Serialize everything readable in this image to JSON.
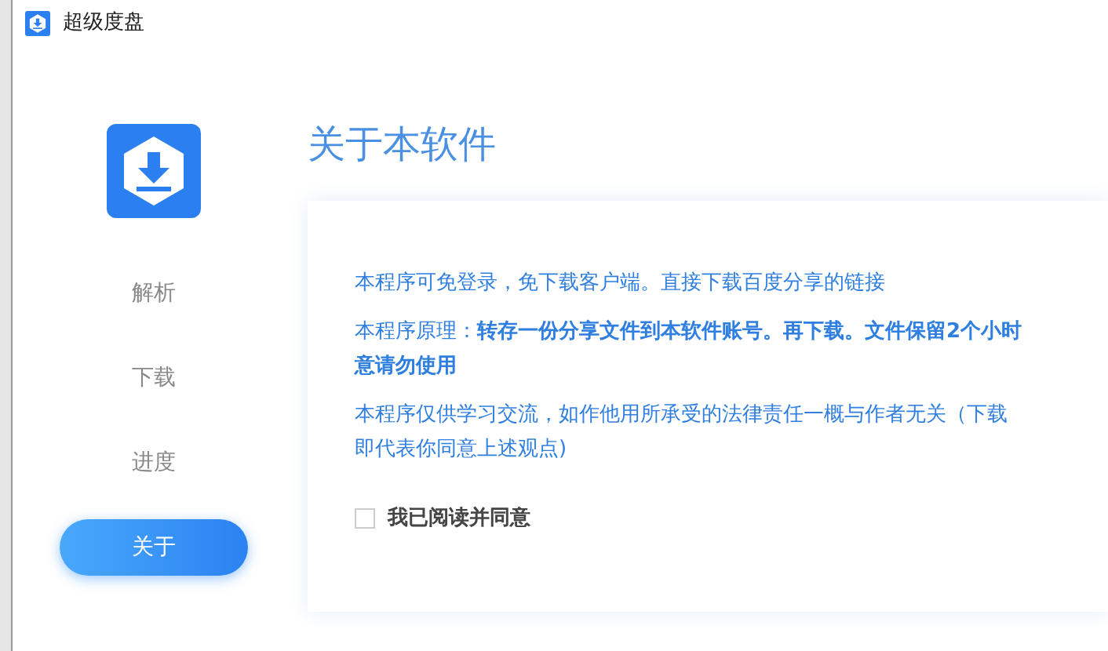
{
  "window": {
    "title": "超级度盘"
  },
  "sidebar": {
    "items": [
      {
        "label": "解析",
        "selected": false
      },
      {
        "label": "下载",
        "selected": false
      },
      {
        "label": "进度",
        "selected": false
      },
      {
        "label": "关于",
        "selected": true
      }
    ]
  },
  "page": {
    "title": "关于本软件",
    "paragraphs": [
      {
        "lines": [
          "本程序可免登录，免下载客户端。直接下载百度分享的链接"
        ]
      },
      {
        "lines": [
          "本程序原理：**转存一份分享文件到本软件账号。再下载。文件保留2个小时**",
          "**意请勿使用**"
        ]
      },
      {
        "lines": [
          "本程序仅供学习交流，如作他用所承受的法律责任一概与作者无关（下载",
          "即代表你同意上述观点)"
        ]
      }
    ],
    "agree": {
      "label": "我已阅读并同意",
      "checked": false
    }
  }
}
